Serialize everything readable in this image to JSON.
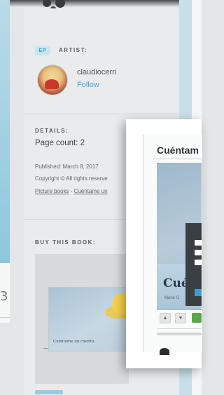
{
  "artist": {
    "badge": "EP",
    "heading": "ARTIST:",
    "name": "claudiocerri",
    "follow_label": "Follow"
  },
  "details": {
    "heading": "DETAILS:",
    "page_count": "Page count: 2",
    "published": "Published: March 8, 2017",
    "copyright": "Copyright © All rights reserve",
    "category": "Picture books",
    "separator": " - ",
    "book_link": "Cuéntame un"
  },
  "buy": {
    "heading": "BUY THIS BOOK:",
    "cover_title": "Cuéntame un cuento"
  },
  "left_panel": {
    "glyph": "3"
  },
  "popup": {
    "title": "Cuéntam",
    "book_title": "Cué",
    "author": "Marie G",
    "buttons": [
      "▲",
      "♥"
    ]
  },
  "colors": {
    "accent": "#4aa3cf",
    "badge_bg": "#c8e6f2",
    "sidebar_bg": "#e9ebec",
    "strip_blue": "#c9dfe9",
    "green_button": "#5aa845"
  }
}
